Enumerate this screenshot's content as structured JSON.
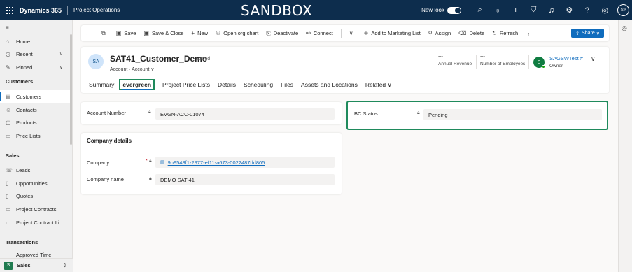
{
  "topbar": {
    "brand": "Dynamics 365",
    "app": "Project Operations",
    "environment": "SANDBOX",
    "new_look_label": "New look",
    "user_initials": "S#",
    "icons": [
      "search-icon",
      "lightbulb-icon",
      "plus-icon",
      "filter-icon",
      "bell-icon",
      "settings-icon",
      "help-icon",
      "copilot-icon"
    ]
  },
  "sidebar": {
    "items": [
      {
        "label": "Home",
        "icon": "home-icon"
      },
      {
        "label": "Recent",
        "icon": "clock-icon"
      },
      {
        "label": "Pinned",
        "icon": "pin-icon"
      }
    ],
    "customers_header": "Customers",
    "customers": [
      {
        "label": "Customers",
        "icon": "building-icon"
      },
      {
        "label": "Contacts",
        "icon": "person-icon"
      },
      {
        "label": "Products",
        "icon": "box-icon"
      },
      {
        "label": "Price Lists",
        "icon": "document-icon"
      }
    ],
    "sales_header": "Sales",
    "sales": [
      {
        "label": "Leads",
        "icon": "phone-icon"
      },
      {
        "label": "Opportunities",
        "icon": "opportunity-icon"
      },
      {
        "label": "Quotes",
        "icon": "quote-icon"
      },
      {
        "label": "Project Contracts",
        "icon": "contract-icon"
      },
      {
        "label": "Project Contract Li...",
        "icon": "contract-line-icon"
      }
    ],
    "transactions_header": "Transactions",
    "transactions_partial": "Approved Time",
    "area_initial": "S",
    "area": "Sales"
  },
  "commands": {
    "save": "Save",
    "save_close": "Save & Close",
    "new": "New",
    "org_chart": "Open org chart",
    "deactivate": "Deactivate",
    "connect": "Connect",
    "marketing": "Add to Marketing List",
    "assign": "Assign",
    "delete": "Delete",
    "refresh": "Refresh",
    "share": "Share"
  },
  "record": {
    "avatar": "SA",
    "title": "SAT41_Customer_Demo",
    "saved": "- Saved",
    "entity": "Account",
    "form": "Account",
    "annual_revenue_value": "---",
    "annual_revenue_label": "Annual Revenue",
    "employees_value": "---",
    "employees_label": "Number of Employees",
    "owner_initial": "S",
    "owner_name": "SAGSWTest #",
    "owner_label": "Owner"
  },
  "tabs": [
    "Summary",
    "evergreen",
    "Project Price Lists",
    "Details",
    "Scheduling",
    "Files",
    "Assets and Locations",
    "Related"
  ],
  "fields": {
    "account_number_label": "Account Number",
    "account_number": "EVGN-ACC-01074",
    "bc_status_label": "BC Status",
    "bc_status": "Pending",
    "company_section": "Company details",
    "company_label": "Company",
    "company_required": "*",
    "company_value": "9b9548f1-2977-ef11-a673-0022487dd805",
    "company_name_label": "Company name",
    "company_name": "DEMO SAT 41"
  },
  "colors": {
    "topbar": "#0d2d4d",
    "accent": "#0f6cbd",
    "highlight_border": "#1f8a5c"
  }
}
